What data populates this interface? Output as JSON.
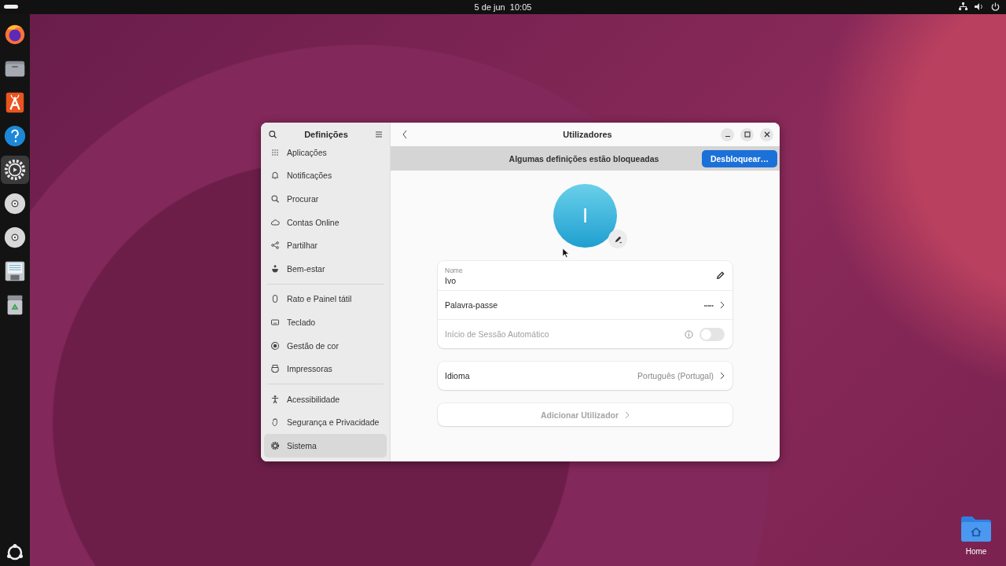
{
  "topbar": {
    "clock": "5 de jun  10:05"
  },
  "dock": {
    "items": [
      {
        "kind": "browser",
        "selected": false
      },
      {
        "kind": "files",
        "selected": false
      },
      {
        "kind": "store",
        "selected": false
      },
      {
        "kind": "help",
        "selected": false
      },
      {
        "kind": "settings",
        "selected": true
      },
      {
        "kind": "disc",
        "selected": false
      },
      {
        "kind": "disc",
        "selected": false
      },
      {
        "kind": "document",
        "selected": false
      },
      {
        "kind": "trash",
        "selected": false
      }
    ]
  },
  "desktop_icons": [
    {
      "label": "Home"
    }
  ],
  "window": {
    "sidebar": {
      "title": "Definições",
      "groups": [
        {
          "items": [
            {
              "label": "Aplicações",
              "kind": "grid",
              "selected": false
            },
            {
              "label": "Notificações",
              "kind": "bell",
              "selected": false
            },
            {
              "label": "Procurar",
              "kind": "search",
              "selected": false
            },
            {
              "label": "Contas Online",
              "kind": "cloud",
              "selected": false
            },
            {
              "label": "Partilhar",
              "kind": "share",
              "selected": false
            },
            {
              "label": "Bem-estar",
              "kind": "wellbeing",
              "selected": false
            }
          ]
        },
        {
          "items": [
            {
              "label": "Rato e Painel tátil",
              "kind": "mouse",
              "selected": false
            },
            {
              "label": "Teclado",
              "kind": "keyboard",
              "selected": false
            },
            {
              "label": "Gestão de cor",
              "kind": "color",
              "selected": false
            },
            {
              "label": "Impressoras",
              "kind": "printer",
              "selected": false
            }
          ]
        },
        {
          "items": [
            {
              "label": "Acessibilidade",
              "kind": "person",
              "selected": false
            },
            {
              "label": "Segurança e Privacidade",
              "kind": "hand",
              "selected": false
            },
            {
              "label": "Sistema",
              "kind": "gear",
              "selected": true
            }
          ]
        }
      ]
    },
    "title": "Utilizadores",
    "banner": {
      "text": "Algumas definições estão bloqueadas",
      "button": "Desbloquear…"
    },
    "avatar": {
      "initial": "I"
    },
    "name_row": {
      "label": "Nome",
      "value": "Ivo"
    },
    "password_row": {
      "label": "Palavra-passe",
      "value": "•••••"
    },
    "autologin_row": {
      "label": "Início de Sessão Automático",
      "disabled": true,
      "on": false
    },
    "language_row": {
      "label": "Idioma",
      "value": "Português (Portugal)"
    },
    "add_user": {
      "label": "Adicionar Utilizador",
      "disabled": true
    }
  }
}
